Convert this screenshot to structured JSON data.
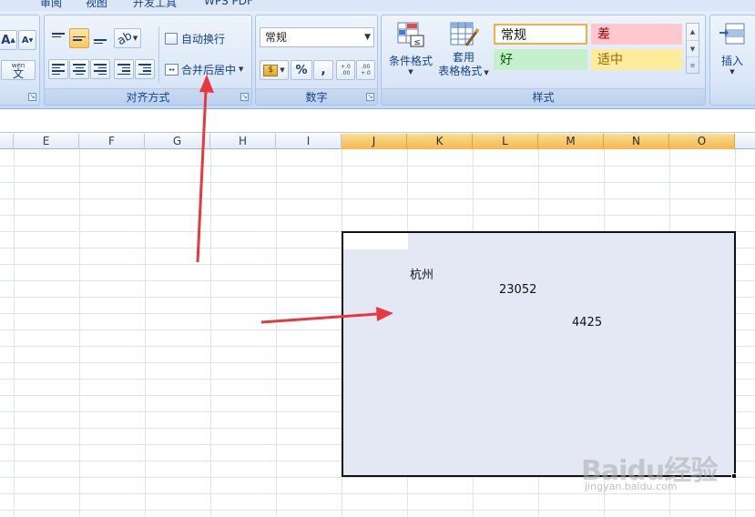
{
  "tabs": [
    {
      "id": "review",
      "label": "审阅"
    },
    {
      "id": "view",
      "label": "视图"
    },
    {
      "id": "developer",
      "label": "开发工具"
    },
    {
      "id": "wps",
      "label": "WPS PDF"
    }
  ],
  "ribbon": {
    "font_group": {
      "grow_font_label": "A",
      "shrink_font_label": "A",
      "phonetic_top_label": "wén",
      "phonetic_label": "文"
    },
    "alignment_group": {
      "caption": "对齐方式",
      "wrap_text_label": "自动换行",
      "merge_center_label": "合并后居中"
    },
    "number_group": {
      "caption": "数字",
      "format_value": "常规",
      "percent_label": "%",
      "comma_label": ",",
      "increase_decimal_label": "+.0 .00",
      "decrease_decimal_label": ".00 +.0"
    },
    "styles_group": {
      "caption": "样式",
      "conditional_format_label": "条件格式",
      "table_format_label_1": "套用",
      "table_format_label_2": "表格格式",
      "style_normal": "常规",
      "style_bad": "差",
      "style_good": "好",
      "style_neutral": "适中"
    },
    "cells_group": {
      "insert_label": "插入"
    }
  },
  "columns": [
    "E",
    "F",
    "G",
    "H",
    "I",
    "J",
    "K",
    "L",
    "M",
    "N",
    "O"
  ],
  "selected_columns": [
    "J",
    "K",
    "L",
    "M",
    "N",
    "O"
  ],
  "cells": [
    {
      "ref": "K",
      "value": "杭州"
    },
    {
      "ref": "L",
      "value": "23052"
    },
    {
      "ref": "M",
      "value": "4425"
    }
  ],
  "colors": {
    "selection_fill": "#e4e8f4",
    "selected_header": "#f3b94f",
    "arrow": "#e8383d",
    "style_bad_bg": "#ffc7ce",
    "style_good_bg": "#c6efce",
    "style_neutral_bg": "#ffeb9c"
  },
  "watermark": {
    "logo": "Baidu经验",
    "url": "jingyan.baidu.com"
  }
}
